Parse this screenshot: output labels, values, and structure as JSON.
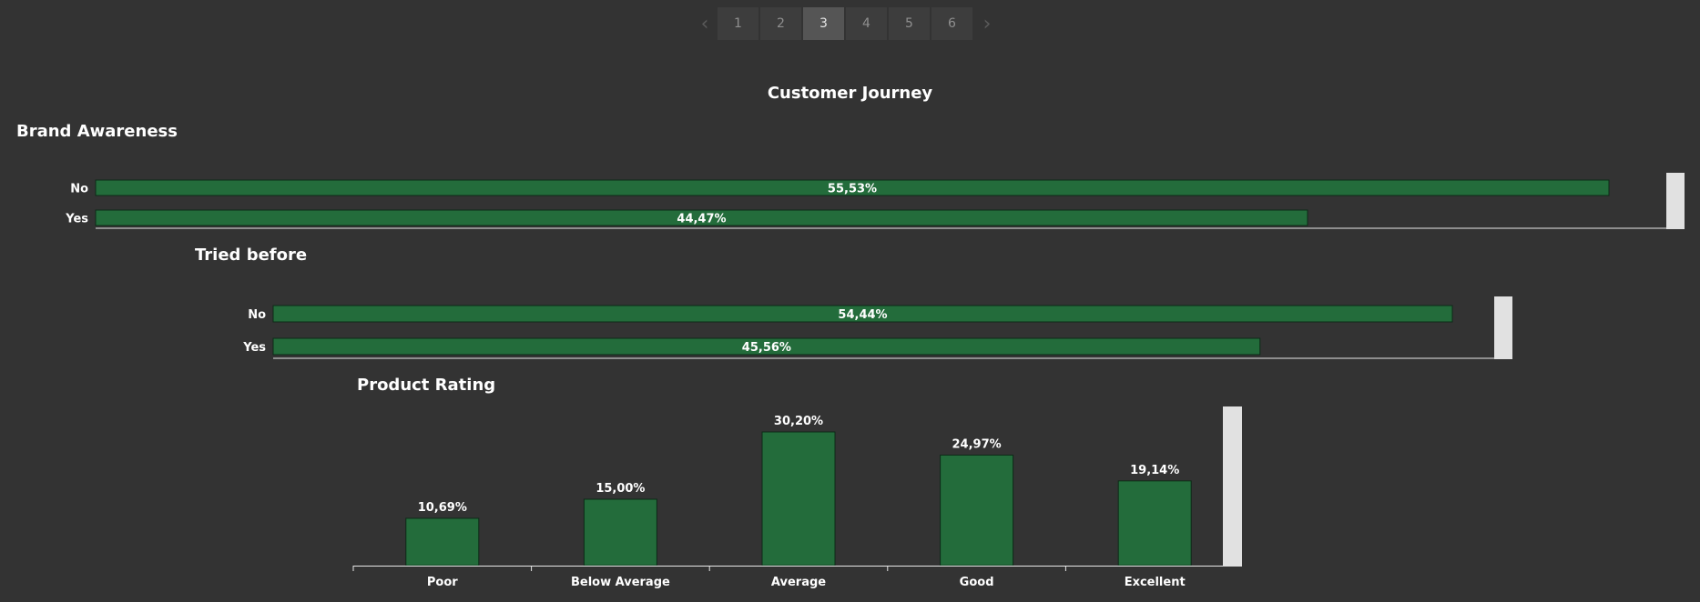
{
  "pager": {
    "prev_icon": "chevron-left-icon",
    "next_icon": "chevron-right-icon",
    "pages": [
      "1",
      "2",
      "3",
      "4",
      "5",
      "6"
    ],
    "active_page": "3"
  },
  "dashboard_title": "Customer Journey",
  "colors": {
    "background": "#333333",
    "bar": "#236c3b",
    "bar_border": "#0d2a17",
    "scroll": "#e1e1e1",
    "text": "#ffffff"
  },
  "chart_data": [
    {
      "type": "bar",
      "orientation": "horizontal",
      "title": "Brand Awareness",
      "categories": [
        "No",
        "Yes"
      ],
      "values": [
        55.53,
        44.47
      ],
      "labels": [
        "55,53%",
        "44,47%"
      ]
    },
    {
      "type": "bar",
      "orientation": "horizontal",
      "title": "Tried before",
      "categories": [
        "No",
        "Yes"
      ],
      "values": [
        54.44,
        45.56
      ],
      "labels": [
        "54,44%",
        "45,56%"
      ]
    },
    {
      "type": "bar",
      "orientation": "vertical",
      "title": "Product Rating",
      "categories": [
        "Poor",
        "Below Average",
        "Average",
        "Good",
        "Excellent"
      ],
      "values": [
        10.69,
        15.0,
        30.2,
        24.97,
        19.14
      ],
      "labels": [
        "10,69%",
        "15,00%",
        "30,20%",
        "24,97%",
        "19,14%"
      ]
    }
  ]
}
